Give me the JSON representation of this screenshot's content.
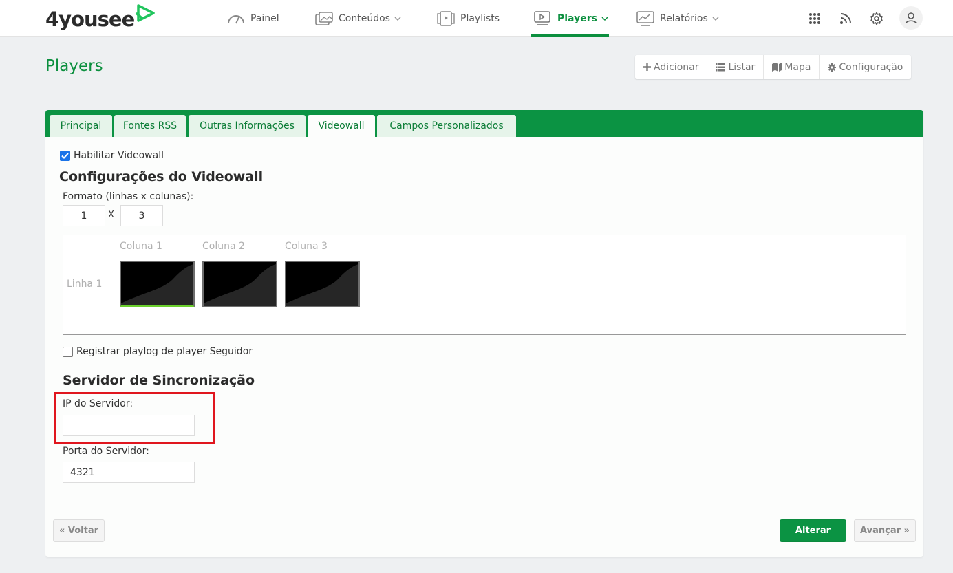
{
  "brand": {
    "name": "4yousee",
    "accent": "#0b9343"
  },
  "nav": {
    "items": [
      {
        "label": "Painel",
        "icon": "gauge-icon"
      },
      {
        "label": "Conteúdos",
        "icon": "images-icon"
      },
      {
        "label": "Playlists",
        "icon": "playlist-icon"
      },
      {
        "label": "Players",
        "icon": "player-icon",
        "active": true
      },
      {
        "label": "Relatórios",
        "icon": "chart-icon"
      }
    ],
    "right_icons": [
      "apps-grid-icon",
      "rss-icon",
      "gear-icon",
      "user-icon"
    ]
  },
  "page": {
    "title": "Players",
    "actions": [
      {
        "label": "Adicionar",
        "icon": "plus-icon"
      },
      {
        "label": "Listar",
        "icon": "list-icon"
      },
      {
        "label": "Mapa",
        "icon": "map-icon"
      },
      {
        "label": "Configuração",
        "icon": "gear-icon"
      }
    ]
  },
  "tabs": [
    {
      "label": "Principal"
    },
    {
      "label": "Fontes RSS"
    },
    {
      "label": "Outras Informações"
    },
    {
      "label": "Videowall",
      "active": true
    },
    {
      "label": "Campos Personalizados"
    }
  ],
  "videowall": {
    "enable_label": "Habilitar Videowall",
    "enabled": true,
    "section_title": "Configurações do Videowall",
    "format_label": "Formato (linhas x colunas):",
    "rows": "1",
    "separator": "X",
    "cols": "3",
    "column_labels": [
      "Coluna 1",
      "Coluna 2",
      "Coluna 3"
    ],
    "row_labels": [
      "Linha 1"
    ],
    "playlog_label": "Registrar playlog de player Seguidor",
    "playlog_checked": false
  },
  "sync": {
    "section_title": "Servidor de Sincronização",
    "ip_label": "IP do Servidor:",
    "ip_value": "",
    "port_label": "Porta do Servidor:",
    "port_value": "4321"
  },
  "footer": {
    "back_label": "« Voltar",
    "submit_label": "Alterar",
    "next_label": "Avançar »"
  }
}
